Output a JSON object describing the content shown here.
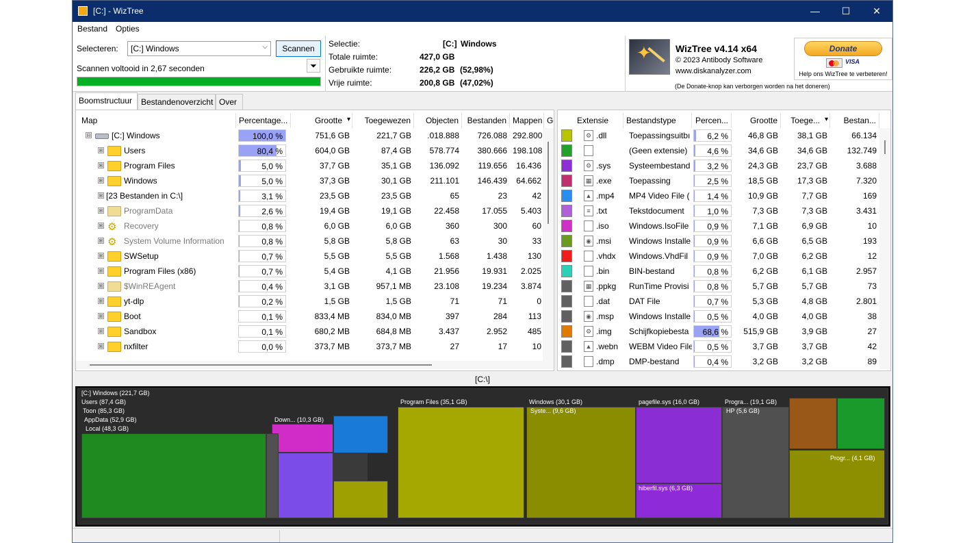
{
  "window": {
    "title": "[C:]  - WizTree",
    "minimize": "—",
    "maximize": "☐",
    "close": "✕"
  },
  "menu": {
    "file": "Bestand",
    "options": "Opties"
  },
  "scan": {
    "select_label": "Selecteren:",
    "drive_value": "[C:] Windows",
    "scan_button": "Scannen",
    "status": "Scannen voltooid in 2,67 seconden",
    "progress": 1.0
  },
  "stats": {
    "selection_label": "Selectie:",
    "selection_drive": "[C:]",
    "selection_name": "Windows",
    "total_label": "Totale ruimte:",
    "total_value": "427,0 GB",
    "used_label": "Gebruikte ruimte:",
    "used_value": "226,2 GB",
    "used_pct": "(52,98%)",
    "free_label": "Vrije ruimte:",
    "free_value": "200,8 GB",
    "free_pct": "(47,02%)"
  },
  "about": {
    "product": "WizTree v4.14 x64",
    "copyright": "© 2023 Antibody Software",
    "site": "www.diskanalyzer.com",
    "donate_button": "Donate",
    "visa": "VISA",
    "help_text": "Help ons WizTree te verbeteren!",
    "donate_note": "(De Donate-knop kan verborgen worden na het doneren)"
  },
  "tabs": [
    "Boomstructuur",
    "Bestandenoverzicht",
    "Over"
  ],
  "tree": {
    "columns": [
      "Map",
      "Percentage...",
      "Grootte",
      "Toegewezen",
      "Objecten",
      "Bestanden",
      "Mappen",
      "Ge"
    ],
    "sort_indicator": "▾",
    "rows": [
      {
        "name": "[C:] Windows",
        "pct": "100,0 %",
        "pct_value": 100.0,
        "size": "751,6 GB",
        "alloc": "221,7 GB",
        "objects": ".018.888",
        "files": "726.088",
        "folders": "292.800",
        "icon": "drive",
        "level": 0,
        "expander": "⊟",
        "style": "normal"
      },
      {
        "name": "Users",
        "pct": "80,4 %",
        "pct_value": 80.4,
        "size": "604,0 GB",
        "alloc": "87,4 GB",
        "objects": "578.774",
        "files": "380.666",
        "folders": "198.108",
        "icon": "folder",
        "level": 1,
        "expander": "⊞",
        "style": "normal"
      },
      {
        "name": "Program Files",
        "pct": "5,0 %",
        "pct_value": 5.0,
        "size": "37,7 GB",
        "alloc": "35,1 GB",
        "objects": "136.092",
        "files": "119.656",
        "folders": "16.436",
        "icon": "folder",
        "level": 1,
        "expander": "⊞",
        "style": "normal"
      },
      {
        "name": "Windows",
        "pct": "5,0 %",
        "pct_value": 5.0,
        "size": "37,3 GB",
        "alloc": "30,1 GB",
        "objects": "211.101",
        "files": "146.439",
        "folders": "64.662",
        "icon": "folder",
        "level": 1,
        "expander": "⊞",
        "style": "normal"
      },
      {
        "name": "[23 Bestanden in C:\\]",
        "pct": "3,1 %",
        "pct_value": 3.1,
        "size": "23,5 GB",
        "alloc": "23,5 GB",
        "objects": "65",
        "files": "23",
        "folders": "42",
        "icon": "none",
        "level": 1,
        "expander": "⊞",
        "style": "normal"
      },
      {
        "name": "ProgramData",
        "pct": "2,6 %",
        "pct_value": 2.6,
        "size": "19,4 GB",
        "alloc": "19,1 GB",
        "objects": "22.458",
        "files": "17.055",
        "folders": "5.403",
        "icon": "folder-grey",
        "level": 1,
        "expander": "⊞",
        "style": "grey"
      },
      {
        "name": "Recovery",
        "pct": "0,8 %",
        "pct_value": 0.8,
        "size": "6,0 GB",
        "alloc": "6,0 GB",
        "objects": "360",
        "files": "300",
        "folders": "60",
        "icon": "gear",
        "level": 1,
        "expander": "⊞",
        "style": "grey"
      },
      {
        "name": "System Volume Information",
        "pct": "0,8 %",
        "pct_value": 0.8,
        "size": "5,8 GB",
        "alloc": "5,8 GB",
        "objects": "63",
        "files": "30",
        "folders": "33",
        "icon": "gear",
        "level": 1,
        "expander": "⊞",
        "style": "grey"
      },
      {
        "name": "SWSetup",
        "pct": "0,7 %",
        "pct_value": 0.7,
        "size": "5,5 GB",
        "alloc": "5,5 GB",
        "objects": "1.568",
        "files": "1.438",
        "folders": "130",
        "icon": "folder",
        "level": 1,
        "expander": "⊞",
        "style": "normal"
      },
      {
        "name": "Program Files (x86)",
        "pct": "0,7 %",
        "pct_value": 0.7,
        "size": "5,4 GB",
        "alloc": "4,1 GB",
        "objects": "21.956",
        "files": "19.931",
        "folders": "2.025",
        "icon": "folder",
        "level": 1,
        "expander": "⊞",
        "style": "normal"
      },
      {
        "name": "$WinREAgent",
        "pct": "0,4 %",
        "pct_value": 0.4,
        "size": "3,1 GB",
        "alloc": "957,1 MB",
        "objects": "23.108",
        "files": "19.234",
        "folders": "3.874",
        "icon": "folder-grey",
        "level": 1,
        "expander": "⊞",
        "style": "grey"
      },
      {
        "name": "yt-dlp",
        "pct": "0,2 %",
        "pct_value": 0.2,
        "size": "1,5 GB",
        "alloc": "1,5 GB",
        "objects": "71",
        "files": "71",
        "folders": "0",
        "icon": "folder",
        "level": 1,
        "expander": "⊞",
        "style": "normal"
      },
      {
        "name": "Boot",
        "pct": "0,1 %",
        "pct_value": 0.1,
        "size": "833,4 MB",
        "alloc": "834,0 MB",
        "objects": "397",
        "files": "284",
        "folders": "113",
        "icon": "folder",
        "level": 1,
        "expander": "⊞",
        "style": "normal"
      },
      {
        "name": "Sandbox",
        "pct": "0,1 %",
        "pct_value": 0.1,
        "size": "680,2 MB",
        "alloc": "684,8 MB",
        "objects": "3.437",
        "files": "2.952",
        "folders": "485",
        "icon": "folder",
        "level": 1,
        "expander": "⊞",
        "style": "normal"
      },
      {
        "name": "nxfilter",
        "pct": "0,0 %",
        "pct_value": 0.0,
        "size": "373,7 MB",
        "alloc": "373,7 MB",
        "objects": "27",
        "files": "17",
        "folders": "10",
        "icon": "folder",
        "level": 1,
        "expander": "⊞",
        "style": "normal"
      }
    ]
  },
  "extensions": {
    "columns": [
      "Extensie",
      "Bestandstype",
      "Percen...",
      "Grootte",
      "Toege...",
      "Bestan..."
    ],
    "sort_indicator": "▾",
    "rows": [
      {
        "color": "#b8c400",
        "icon": "⚙",
        "ext": ".dll",
        "type": "Toepassingsuitbı",
        "pct": "6,2 %",
        "pct_value": 6.2,
        "size": "46,8 GB",
        "alloc": "38,1 GB",
        "files": "66.134"
      },
      {
        "color": "#22a22a",
        "icon": "",
        "ext": "",
        "type": "(Geen extensie)",
        "pct": "4,6 %",
        "pct_value": 4.6,
        "size": "34,6 GB",
        "alloc": "34,6 GB",
        "files": "132.749"
      },
      {
        "color": "#8d2fd6",
        "icon": "⚙",
        "ext": ".sys",
        "type": "Systeembestand",
        "pct": "3,2 %",
        "pct_value": 3.2,
        "size": "24,3 GB",
        "alloc": "23,7 GB",
        "files": "3.688"
      },
      {
        "color": "#c03070",
        "icon": "▦",
        "ext": ".exe",
        "type": "Toepassing",
        "pct": "2,5 %",
        "pct_value": 2.5,
        "size": "18,5 GB",
        "alloc": "17,3 GB",
        "files": "7.320"
      },
      {
        "color": "#2a8ef0",
        "icon": "▲",
        "ext": ".mp4",
        "type": "MP4 Video File (",
        "pct": "1,4 %",
        "pct_value": 1.4,
        "size": "10,9 GB",
        "alloc": "7,7 GB",
        "files": "169"
      },
      {
        "color": "#b060d8",
        "icon": "≡",
        "ext": ".txt",
        "type": "Tekstdocument",
        "pct": "1,0 %",
        "pct_value": 1.0,
        "size": "7,3 GB",
        "alloc": "7,3 GB",
        "files": "3.431"
      },
      {
        "color": "#d030c8",
        "icon": "",
        "ext": ".iso",
        "type": "Windows.IsoFile",
        "pct": "0,9 %",
        "pct_value": 0.9,
        "size": "7,1 GB",
        "alloc": "6,9 GB",
        "files": "10"
      },
      {
        "color": "#6a9a20",
        "icon": "◉",
        "ext": ".msi",
        "type": "Windows Installe",
        "pct": "0,9 %",
        "pct_value": 0.9,
        "size": "6,6 GB",
        "alloc": "6,5 GB",
        "files": "193"
      },
      {
        "color": "#ee1c1c",
        "icon": "",
        "ext": ".vhdx",
        "type": "Windows.VhdFil",
        "pct": "0,9 %",
        "pct_value": 0.9,
        "size": "7,0 GB",
        "alloc": "6,2 GB",
        "files": "12"
      },
      {
        "color": "#2ad0b8",
        "icon": "",
        "ext": ".bin",
        "type": "BIN-bestand",
        "pct": "0,8 %",
        "pct_value": 0.8,
        "size": "6,2 GB",
        "alloc": "6,1 GB",
        "files": "2.957"
      },
      {
        "color": "#606060",
        "icon": "▦",
        "ext": ".ppkg",
        "type": "RunTime Provisi",
        "pct": "0,8 %",
        "pct_value": 0.8,
        "size": "5,7 GB",
        "alloc": "5,7 GB",
        "files": "73"
      },
      {
        "color": "#606060",
        "icon": "",
        "ext": ".dat",
        "type": "DAT File",
        "pct": "0,7 %",
        "pct_value": 0.7,
        "size": "5,3 GB",
        "alloc": "4,8 GB",
        "files": "2.801"
      },
      {
        "color": "#606060",
        "icon": "◉",
        "ext": ".msp",
        "type": "Windows Installe",
        "pct": "0,5 %",
        "pct_value": 0.5,
        "size": "4,0 GB",
        "alloc": "4,0 GB",
        "files": "38"
      },
      {
        "color": "#e07a00",
        "icon": "⚙",
        "ext": ".img",
        "type": "Schijfkopiebesta",
        "pct": "68,6 %",
        "pct_value": 68.6,
        "size": "515,9 GB",
        "alloc": "3,9 GB",
        "files": "27"
      },
      {
        "color": "#606060",
        "icon": "▲",
        "ext": ".webn",
        "type": "WEBM Video File",
        "pct": "0,5 %",
        "pct_value": 0.5,
        "size": "3,7 GB",
        "alloc": "3,7 GB",
        "files": "42"
      },
      {
        "color": "#606060",
        "icon": "",
        "ext": ".dmp",
        "type": "DMP-bestand",
        "pct": "0,4 %",
        "pct_value": 0.4,
        "size": "3,2 GB",
        "alloc": "3,2 GB",
        "files": "89"
      }
    ]
  },
  "treemap": {
    "path": "[C:\\]",
    "labels": {
      "root": "[C:] Windows  (221,7 GB)",
      "users": "Users  (87,4 GB)",
      "toon": "Toon  (85,3 GB)",
      "appdata": "AppData  (52,9 GB)",
      "local": "Local  (48,3 GB)",
      "downloads": "Down...  (10,3 GB)",
      "programfiles": "Program Files  (35,1 GB)",
      "windows": "Windows  (30,1 GB)",
      "system": "Syste...  (9,6 GB)",
      "pagefile": "pagefile.sys  (16,0 GB)",
      "hiberfil": "hiberfil.sys  (6,3 GB)",
      "progra": "Progra...  (19,1 GB)",
      "hp": "HP  (5,6 GB)",
      "progr2": "Progr...  (4,1 GB)"
    }
  }
}
